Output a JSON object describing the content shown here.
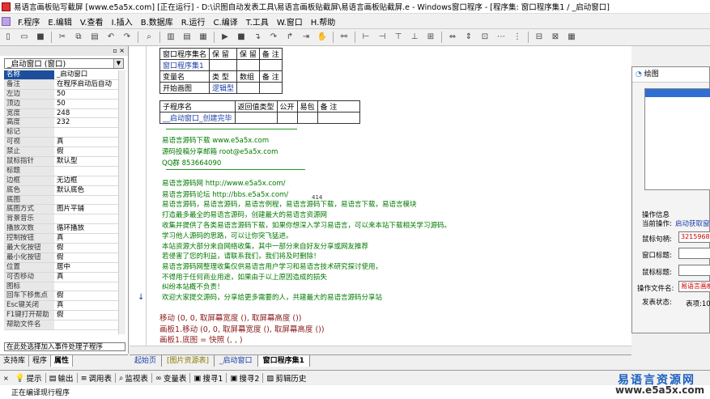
{
  "window_title": "易语言画板贴写截屏 [www.e5a5x.com] [正在运行] - D:\\识图自动发表工具\\易语言画板贴截屏\\易语言画板贴截屏.e - Windows窗口程序 - [程序集: 窗口程序集1 / _启动窗口]",
  "menu": [
    "F.程序",
    "E.编辑",
    "V.查看",
    "I.插入",
    "B.数据库",
    "R.运行",
    "C.编译",
    "T.工具",
    "W.窗口",
    "H.帮助"
  ],
  "left_panel": {
    "close_controls": "▫ ×",
    "combo_value": "_启动窗口 (窗口)",
    "properties": [
      {
        "k": "名称",
        "v": "_启动窗口"
      },
      {
        "k": "备注",
        "v": "在程序启动后自动"
      },
      {
        "k": "左边",
        "v": "50"
      },
      {
        "k": "顶边",
        "v": "50"
      },
      {
        "k": "宽度",
        "v": "248"
      },
      {
        "k": "高度",
        "v": "232"
      },
      {
        "k": "标记",
        "v": ""
      },
      {
        "k": "可视",
        "v": "真"
      },
      {
        "k": "禁止",
        "v": "假"
      },
      {
        "k": "鼠标指针",
        "v": "默认型"
      },
      {
        "k": "标题",
        "v": ""
      },
      {
        "k": "边框",
        "v": "无边框"
      },
      {
        "k": "底色",
        "v": "默认底色"
      },
      {
        "k": "底图",
        "v": ""
      },
      {
        "k": "  底图方式",
        "v": "图片平铺"
      },
      {
        "k": "背景音乐",
        "v": ""
      },
      {
        "k": "  播放次数",
        "v": "循环播放"
      },
      {
        "k": "控制按钮",
        "v": "真"
      },
      {
        "k": "  最大化按钮",
        "v": "假"
      },
      {
        "k": "  最小化按钮",
        "v": "假"
      },
      {
        "k": "位置",
        "v": "居中"
      },
      {
        "k": "可否移动",
        "v": "真"
      },
      {
        "k": "图标",
        "v": ""
      },
      {
        "k": "回车下移焦点",
        "v": "假"
      },
      {
        "k": "Esc键关闭",
        "v": "真"
      },
      {
        "k": "F1键打开帮助",
        "v": "假"
      },
      {
        "k": "  帮助文件名",
        "v": ""
      }
    ],
    "footer_text": "在此处选择加入事件处理子程序",
    "tabs": [
      "支持库",
      "程序",
      "属性"
    ]
  },
  "editor": {
    "set_table": {
      "headers": [
        "窗口程序集名",
        "保 留",
        "保 留",
        "备 注"
      ],
      "row": [
        "窗口程序集1",
        "",
        "",
        ""
      ]
    },
    "var_table": {
      "headers": [
        "变量名",
        "类 型",
        "数组",
        "备 注"
      ],
      "row": [
        "开始画图",
        "逻辑型",
        "",
        ""
      ]
    },
    "sub_table": {
      "headers": [
        "子程序名",
        "返回值类型",
        "公开",
        "易包",
        "备 注"
      ],
      "row": [
        "__启动窗口_创建完毕",
        "",
        "",
        "",
        ""
      ]
    },
    "comments": [
      "易语言源码下载    www.e5a5x.com",
      "源码投稿分享邮箱  root@e5a5x.com",
      "QQ群    853664090",
      "易语言源码网 http://www.e5a5x.com/",
      "易语言源码论坛 http://bbs.e5a5x.com/",
      "易语言源码，易语言源码，易语言例程，易语言源码下载，易语言下载，易语言模块",
      "打造最多最全的易语言源码，创建最大的易语言资源网",
      "收集并提供了各类易语言源码下载，如果你想深入学习易语言，可以来本站下载相关学习源码。",
      "学习他人源码的思路，可以让你突飞猛进。",
      "本站资源大部分来自网络收集，其中一部分来自好友分享或网友推荐",
      "若侵害了您的利益，请联系我们，我们将及时删除！",
      "易语言源码网整理收集仅供易语言用户学习和易语言技术研究探讨使用，",
      "不得用于任何商业用途，如果由于以上原因造成的损失",
      "纠纷本站概不负责！",
      "欢迎大家提交源码，分享给更多需要的人，共建最大的易语言源码分享站"
    ],
    "code_lines": [
      "移动 (0, 0, 取屏幕宽度 (), 取屏幕高度 ())",
      "画板1.移动 (0, 0, 取屏幕宽度 (), 取屏幕高度 ())",
      "画板1.底图 = 快照 (, , )"
    ],
    "cursor_label": "414",
    "tabs": [
      "起始页",
      "[图片资源表]",
      "_启动窗口",
      "窗口程序集1"
    ]
  },
  "float_window": {
    "title": "绘图",
    "labels": {
      "op_info": "操作信息",
      "current_op": "当前操作:",
      "current_op_value": "启动获取窗",
      "mouse_handle": "鼠标句柄:",
      "mouse_handle_value": "3215968",
      "window_title": "窗口标题:",
      "mouse_title": "鼠标标题:",
      "op_file": "操作文件名:",
      "op_file_value": "易语言画板",
      "send_status": "发表状态:",
      "send_status_value": "表项:10"
    }
  },
  "bottom_tabs": [
    "提示",
    "输出",
    "调用表",
    "监视表",
    "变量表",
    "搜寻1",
    "搜寻2",
    "剪辑历史"
  ],
  "output_text": "正在编译现行程序",
  "watermark": {
    "line1": "易语言资源网",
    "line2": "www.e5a5x.com"
  }
}
